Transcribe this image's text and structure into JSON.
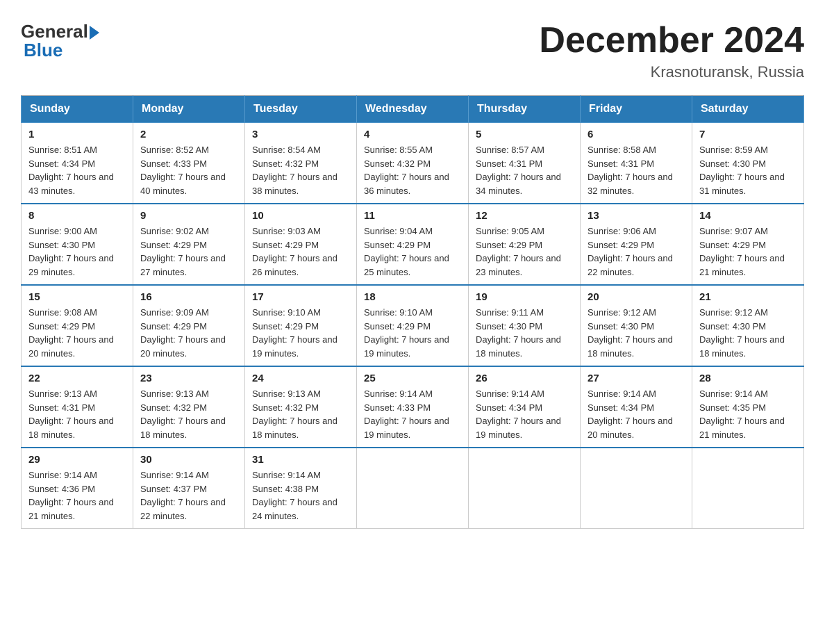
{
  "header": {
    "logo_general": "General",
    "logo_blue": "Blue",
    "month_title": "December 2024",
    "location": "Krasnoturansk, Russia"
  },
  "days_of_week": [
    "Sunday",
    "Monday",
    "Tuesday",
    "Wednesday",
    "Thursday",
    "Friday",
    "Saturday"
  ],
  "weeks": [
    [
      {
        "day": "1",
        "sunrise": "8:51 AM",
        "sunset": "4:34 PM",
        "daylight": "7 hours and 43 minutes."
      },
      {
        "day": "2",
        "sunrise": "8:52 AM",
        "sunset": "4:33 PM",
        "daylight": "7 hours and 40 minutes."
      },
      {
        "day": "3",
        "sunrise": "8:54 AM",
        "sunset": "4:32 PM",
        "daylight": "7 hours and 38 minutes."
      },
      {
        "day": "4",
        "sunrise": "8:55 AM",
        "sunset": "4:32 PM",
        "daylight": "7 hours and 36 minutes."
      },
      {
        "day": "5",
        "sunrise": "8:57 AM",
        "sunset": "4:31 PM",
        "daylight": "7 hours and 34 minutes."
      },
      {
        "day": "6",
        "sunrise": "8:58 AM",
        "sunset": "4:31 PM",
        "daylight": "7 hours and 32 minutes."
      },
      {
        "day": "7",
        "sunrise": "8:59 AM",
        "sunset": "4:30 PM",
        "daylight": "7 hours and 31 minutes."
      }
    ],
    [
      {
        "day": "8",
        "sunrise": "9:00 AM",
        "sunset": "4:30 PM",
        "daylight": "7 hours and 29 minutes."
      },
      {
        "day": "9",
        "sunrise": "9:02 AM",
        "sunset": "4:29 PM",
        "daylight": "7 hours and 27 minutes."
      },
      {
        "day": "10",
        "sunrise": "9:03 AM",
        "sunset": "4:29 PM",
        "daylight": "7 hours and 26 minutes."
      },
      {
        "day": "11",
        "sunrise": "9:04 AM",
        "sunset": "4:29 PM",
        "daylight": "7 hours and 25 minutes."
      },
      {
        "day": "12",
        "sunrise": "9:05 AM",
        "sunset": "4:29 PM",
        "daylight": "7 hours and 23 minutes."
      },
      {
        "day": "13",
        "sunrise": "9:06 AM",
        "sunset": "4:29 PM",
        "daylight": "7 hours and 22 minutes."
      },
      {
        "day": "14",
        "sunrise": "9:07 AM",
        "sunset": "4:29 PM",
        "daylight": "7 hours and 21 minutes."
      }
    ],
    [
      {
        "day": "15",
        "sunrise": "9:08 AM",
        "sunset": "4:29 PM",
        "daylight": "7 hours and 20 minutes."
      },
      {
        "day": "16",
        "sunrise": "9:09 AM",
        "sunset": "4:29 PM",
        "daylight": "7 hours and 20 minutes."
      },
      {
        "day": "17",
        "sunrise": "9:10 AM",
        "sunset": "4:29 PM",
        "daylight": "7 hours and 19 minutes."
      },
      {
        "day": "18",
        "sunrise": "9:10 AM",
        "sunset": "4:29 PM",
        "daylight": "7 hours and 19 minutes."
      },
      {
        "day": "19",
        "sunrise": "9:11 AM",
        "sunset": "4:30 PM",
        "daylight": "7 hours and 18 minutes."
      },
      {
        "day": "20",
        "sunrise": "9:12 AM",
        "sunset": "4:30 PM",
        "daylight": "7 hours and 18 minutes."
      },
      {
        "day": "21",
        "sunrise": "9:12 AM",
        "sunset": "4:30 PM",
        "daylight": "7 hours and 18 minutes."
      }
    ],
    [
      {
        "day": "22",
        "sunrise": "9:13 AM",
        "sunset": "4:31 PM",
        "daylight": "7 hours and 18 minutes."
      },
      {
        "day": "23",
        "sunrise": "9:13 AM",
        "sunset": "4:32 PM",
        "daylight": "7 hours and 18 minutes."
      },
      {
        "day": "24",
        "sunrise": "9:13 AM",
        "sunset": "4:32 PM",
        "daylight": "7 hours and 18 minutes."
      },
      {
        "day": "25",
        "sunrise": "9:14 AM",
        "sunset": "4:33 PM",
        "daylight": "7 hours and 19 minutes."
      },
      {
        "day": "26",
        "sunrise": "9:14 AM",
        "sunset": "4:34 PM",
        "daylight": "7 hours and 19 minutes."
      },
      {
        "day": "27",
        "sunrise": "9:14 AM",
        "sunset": "4:34 PM",
        "daylight": "7 hours and 20 minutes."
      },
      {
        "day": "28",
        "sunrise": "9:14 AM",
        "sunset": "4:35 PM",
        "daylight": "7 hours and 21 minutes."
      }
    ],
    [
      {
        "day": "29",
        "sunrise": "9:14 AM",
        "sunset": "4:36 PM",
        "daylight": "7 hours and 21 minutes."
      },
      {
        "day": "30",
        "sunrise": "9:14 AM",
        "sunset": "4:37 PM",
        "daylight": "7 hours and 22 minutes."
      },
      {
        "day": "31",
        "sunrise": "9:14 AM",
        "sunset": "4:38 PM",
        "daylight": "7 hours and 24 minutes."
      },
      null,
      null,
      null,
      null
    ]
  ]
}
